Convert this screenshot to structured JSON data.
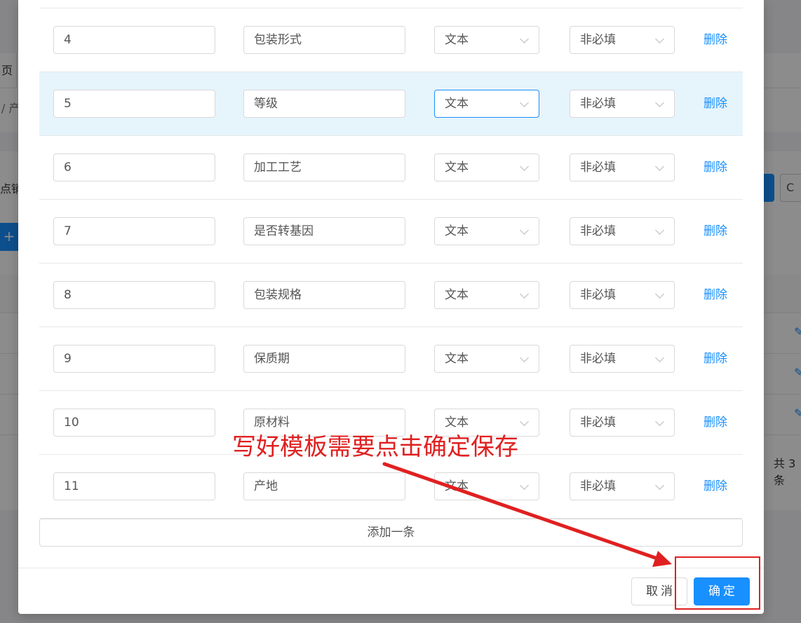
{
  "background": {
    "tab_fragment": "页",
    "crumb_fragment": "/ 产",
    "left_label_fragment": "点销",
    "add_glyph": "+",
    "refresh_glyph": "C",
    "edit_glyph": "✎",
    "total_fragment": "共 3 条"
  },
  "rows": [
    {
      "num": "4",
      "name": "包装形式",
      "type": "文本",
      "required": "非必填",
      "action": "删除"
    },
    {
      "num": "5",
      "name": "等级",
      "type": "文本",
      "required": "非必填",
      "action": "删除"
    },
    {
      "num": "6",
      "name": "加工工艺",
      "type": "文本",
      "required": "非必填",
      "action": "删除"
    },
    {
      "num": "7",
      "name": "是否转基因",
      "type": "文本",
      "required": "非必填",
      "action": "删除"
    },
    {
      "num": "8",
      "name": "包装规格",
      "type": "文本",
      "required": "非必填",
      "action": "删除"
    },
    {
      "num": "9",
      "name": "保质期",
      "type": "文本",
      "required": "非必填",
      "action": "删除"
    },
    {
      "num": "10",
      "name": "原材料",
      "type": "文本",
      "required": "非必填",
      "action": "删除"
    },
    {
      "num": "11",
      "name": "产地",
      "type": "文本",
      "required": "非必填",
      "action": "删除"
    }
  ],
  "add_row_label": "添加一条",
  "footer": {
    "cancel_label": "取消",
    "ok_label": "确定"
  },
  "annotation": {
    "text": "写好模板需要点击确定保存",
    "color": "#e02020"
  },
  "colors": {
    "primary": "#1890ff",
    "highlight_row": "#e6f4fc"
  }
}
